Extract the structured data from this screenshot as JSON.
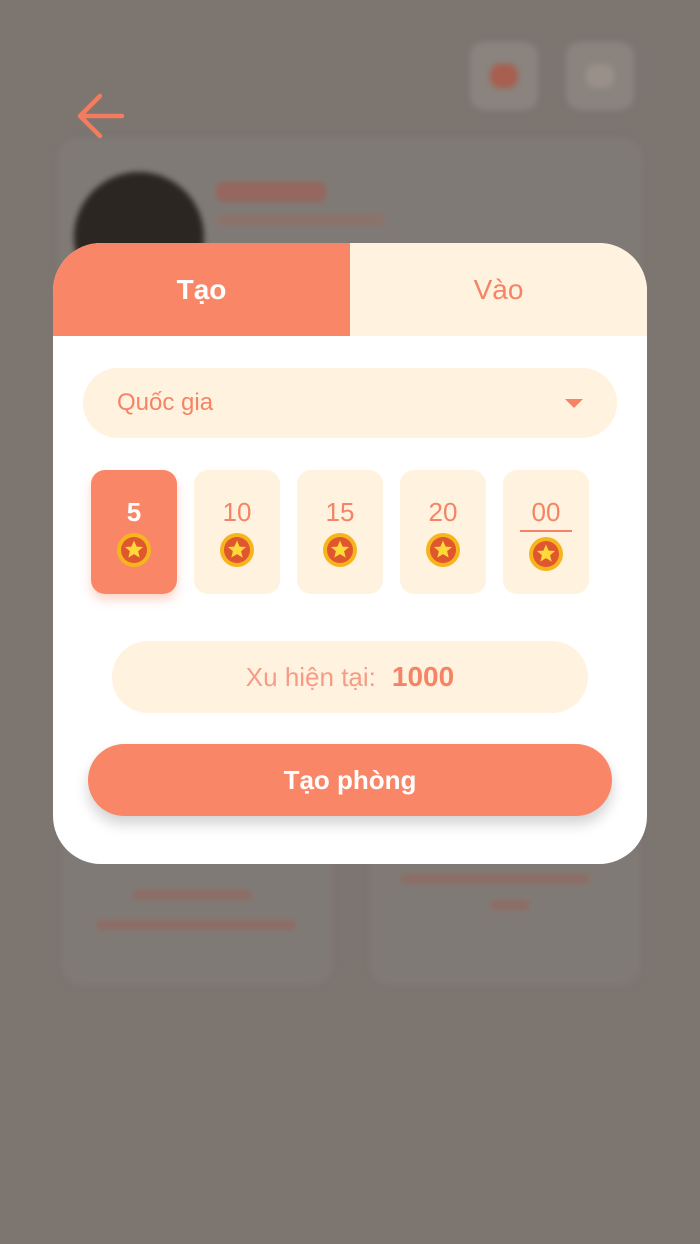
{
  "tabs": {
    "create_label": "Tạo",
    "join_label": "Vào"
  },
  "country_select": {
    "placeholder": "Quốc gia"
  },
  "bet_options": [
    {
      "value": "5",
      "selected": true
    },
    {
      "value": "10",
      "selected": false
    },
    {
      "value": "15",
      "selected": false
    },
    {
      "value": "20",
      "selected": false
    },
    {
      "value": "00",
      "selected": false
    }
  ],
  "balance": {
    "label": "Xu hiện tại:",
    "amount": "1000"
  },
  "create_button_label": "Tạo phòng",
  "icons": {
    "back": "arrow-left-icon",
    "coin": "star-coin-icon",
    "dropdown": "caret-down-icon"
  },
  "colors": {
    "accent": "#f98767",
    "accent_text": "#f58466",
    "soft_bg": "#fff2de",
    "overlay": "#7d7570"
  }
}
